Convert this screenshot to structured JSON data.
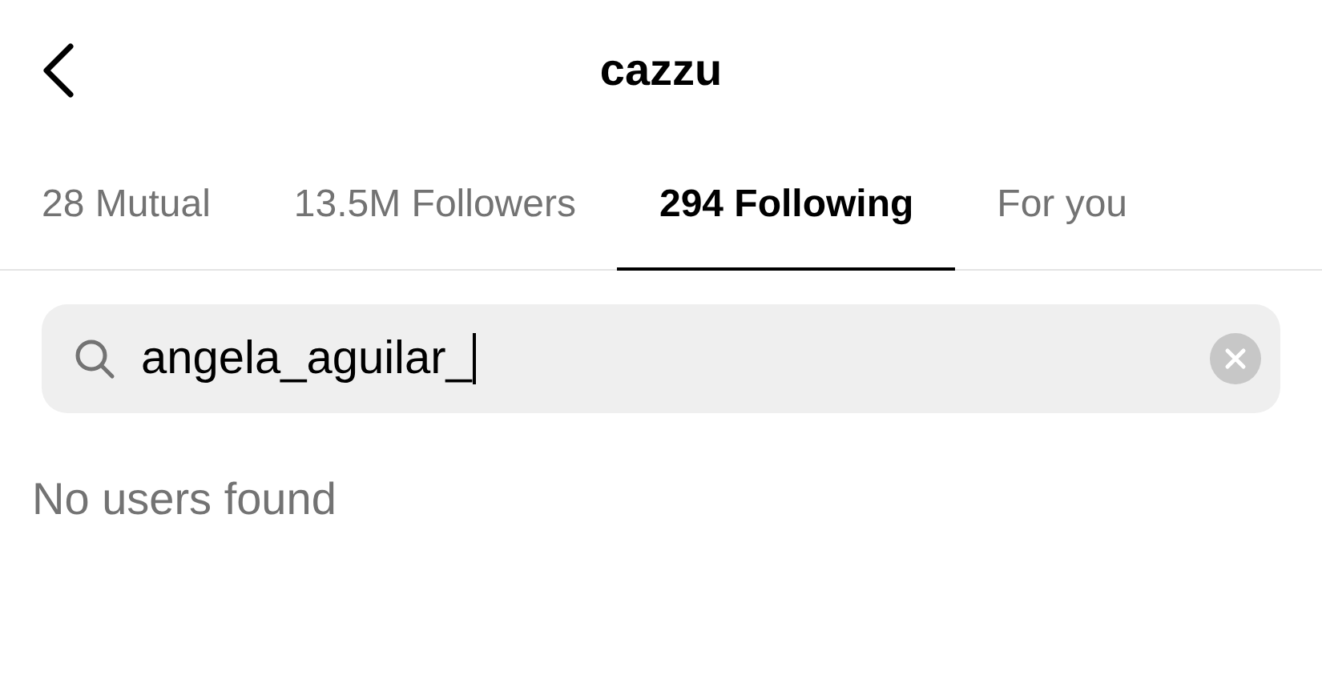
{
  "header": {
    "title": "cazzu"
  },
  "tabs": [
    {
      "label": "28 Mutual",
      "selected": false
    },
    {
      "label": "13.5M Followers",
      "selected": false
    },
    {
      "label": "294 Following",
      "selected": true
    },
    {
      "label": "For you",
      "selected": false
    }
  ],
  "search": {
    "value": "angela_aguilar_"
  },
  "empty_message": "No users found"
}
